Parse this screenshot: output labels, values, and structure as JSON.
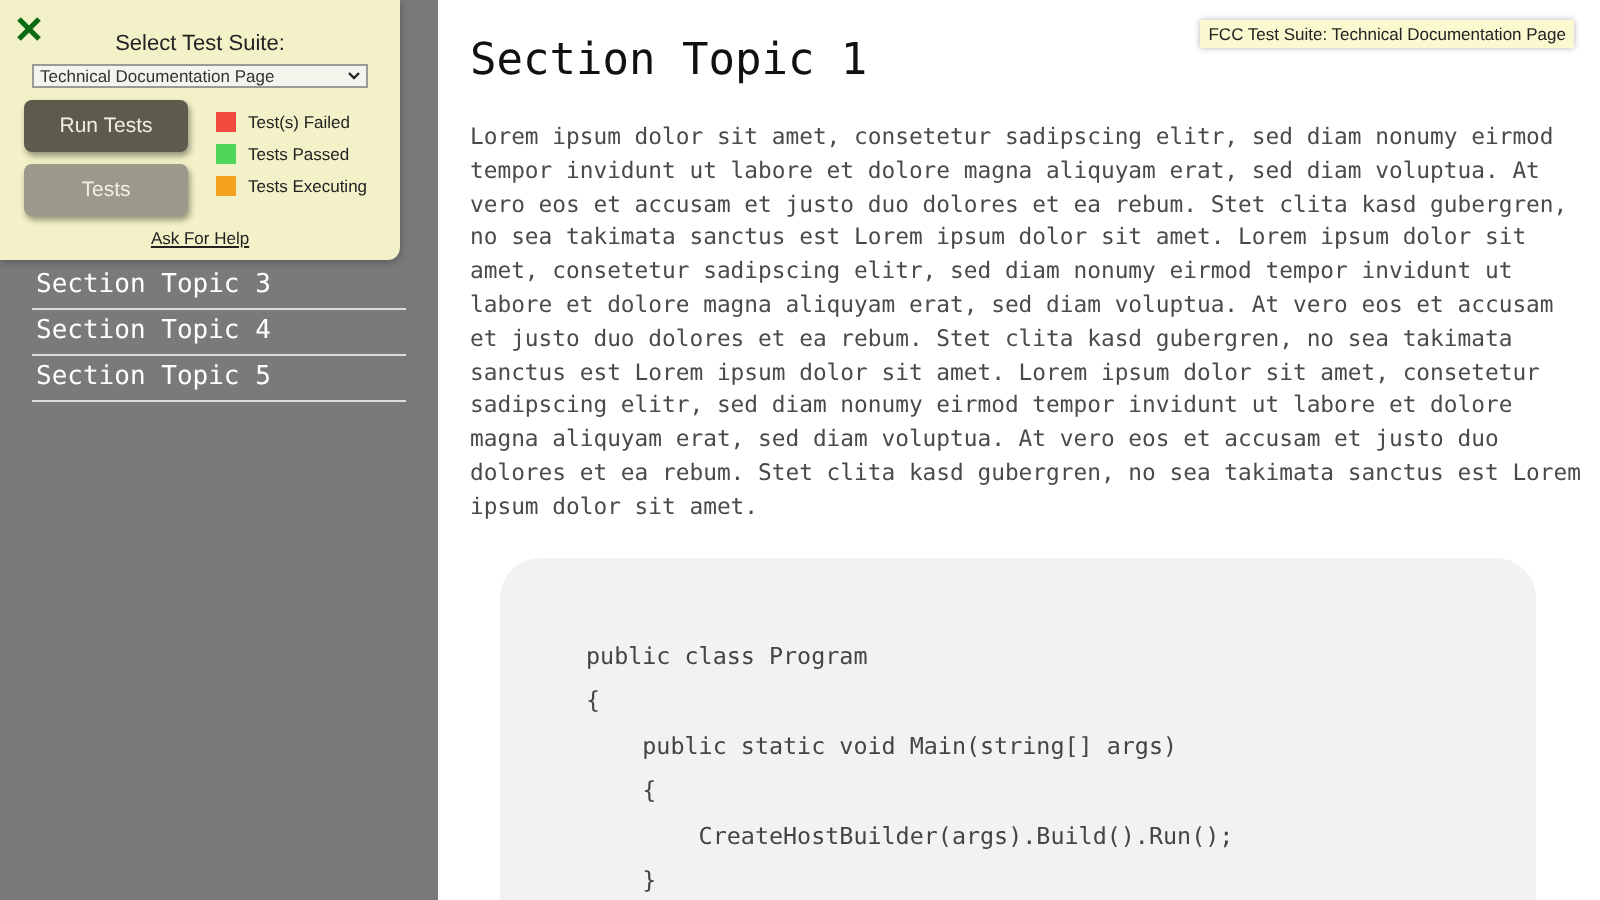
{
  "sidebar": {
    "items": [
      {
        "label": "Section Topic 3"
      },
      {
        "label": "Section Topic 4"
      },
      {
        "label": "Section Topic 5"
      }
    ]
  },
  "test_panel": {
    "title": "Select Test Suite:",
    "suite": "Technical Documentation Page",
    "buttons": [
      {
        "label": "Run Tests",
        "kind": "primary"
      },
      {
        "label": "Tests",
        "kind": "secondary"
      }
    ],
    "legend": [
      {
        "label": "Test(s) Failed",
        "color": "#f24b3f"
      },
      {
        "label": "Tests Passed",
        "color": "#4fd65a"
      },
      {
        "label": "Tests Executing",
        "color": "#f5a11c"
      }
    ],
    "help_link": "Ask For Help"
  },
  "tooltip": "FCC Test Suite: Technical Documentation Page",
  "section": {
    "title": "Section Topic 1",
    "paragraph": "Lorem ipsum dolor sit amet, consetetur sadipscing elitr, sed diam nonumy eirmod tempor invidunt ut labore et dolore magna aliquyam erat, sed diam voluptua. At vero eos et accusam et justo duo dolores et ea rebum. Stet clita kasd gubergren, no sea takimata sanctus est Lorem ipsum dolor sit amet. Lorem ipsum dolor sit amet, consetetur sadipscing elitr, sed diam nonumy eirmod tempor invidunt ut labore et dolore magna aliquyam erat, sed diam voluptua. At vero eos et accusam et justo duo dolores et ea rebum. Stet clita kasd gubergren, no sea takimata sanctus est Lorem ipsum dolor sit amet. Lorem ipsum dolor sit amet, consetetur sadipscing elitr, sed diam nonumy eirmod tempor invidunt ut labore et dolore magna aliquyam erat, sed diam voluptua. At vero eos et accusam et justo duo dolores et ea rebum. Stet clita kasd gubergren, no sea takimata sanctus est Lorem ipsum dolor sit amet.",
    "code": [
      "public class Program",
      "{",
      "    public static void Main(string[] args)",
      "    {",
      "        CreateHostBuilder(args).Build().Run();",
      "    }"
    ]
  }
}
